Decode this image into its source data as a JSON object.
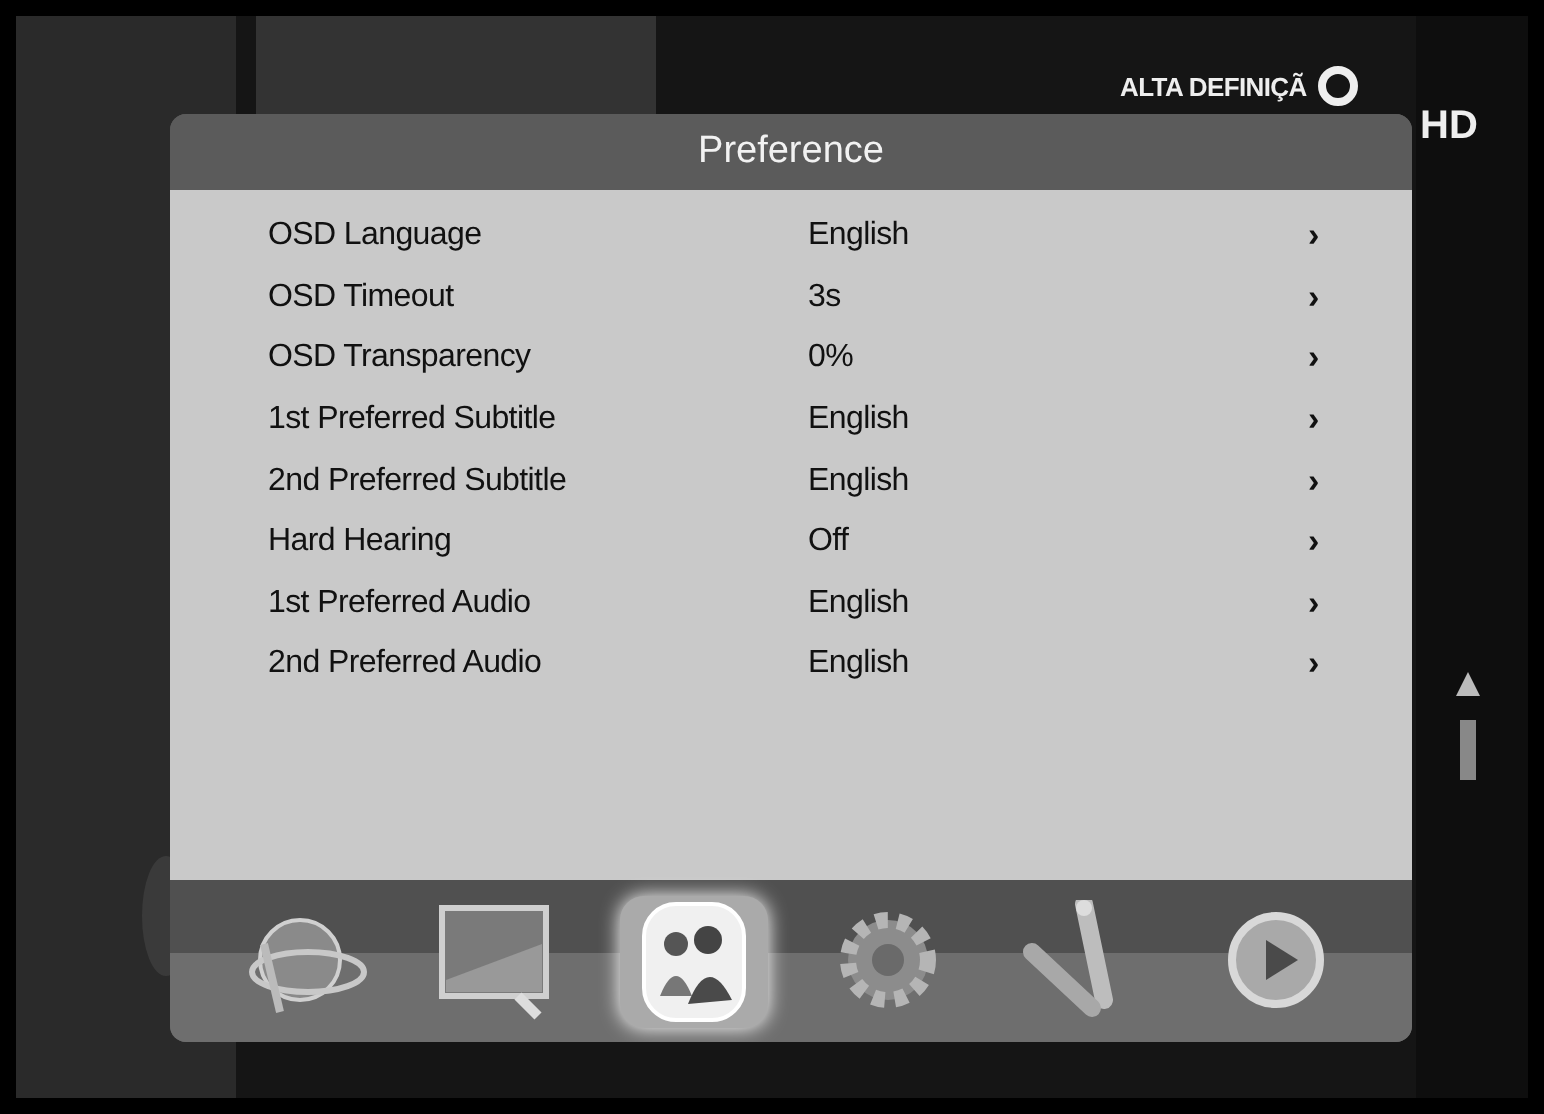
{
  "channel_banner": {
    "text": "ALTA DEFINIÇÃ",
    "badge": "HD"
  },
  "window": {
    "title": "Preference"
  },
  "settings": [
    {
      "label": "OSD Language",
      "value": "English",
      "arrow": "›"
    },
    {
      "label": "OSD Timeout",
      "value": "3s",
      "arrow": "›"
    },
    {
      "label": "OSD Transparency",
      "value": "0%",
      "arrow": "›"
    },
    {
      "label": "1st Preferred Subtitle",
      "value": "English",
      "arrow": "›"
    },
    {
      "label": "2nd Preferred Subtitle",
      "value": "English",
      "arrow": "›"
    },
    {
      "label": "Hard Hearing",
      "value": "Off",
      "arrow": "›"
    },
    {
      "label": "1st Preferred Audio",
      "value": "English",
      "arrow": "›"
    },
    {
      "label": "2nd Preferred Audio",
      "value": "English",
      "arrow": "›"
    }
  ],
  "menu_bar": [
    {
      "kind": "globe",
      "selected": false
    },
    {
      "kind": "monitor",
      "selected": false
    },
    {
      "kind": "people",
      "selected": true
    },
    {
      "kind": "gear",
      "selected": false
    },
    {
      "kind": "plugs",
      "selected": false
    },
    {
      "kind": "play",
      "selected": false
    }
  ]
}
